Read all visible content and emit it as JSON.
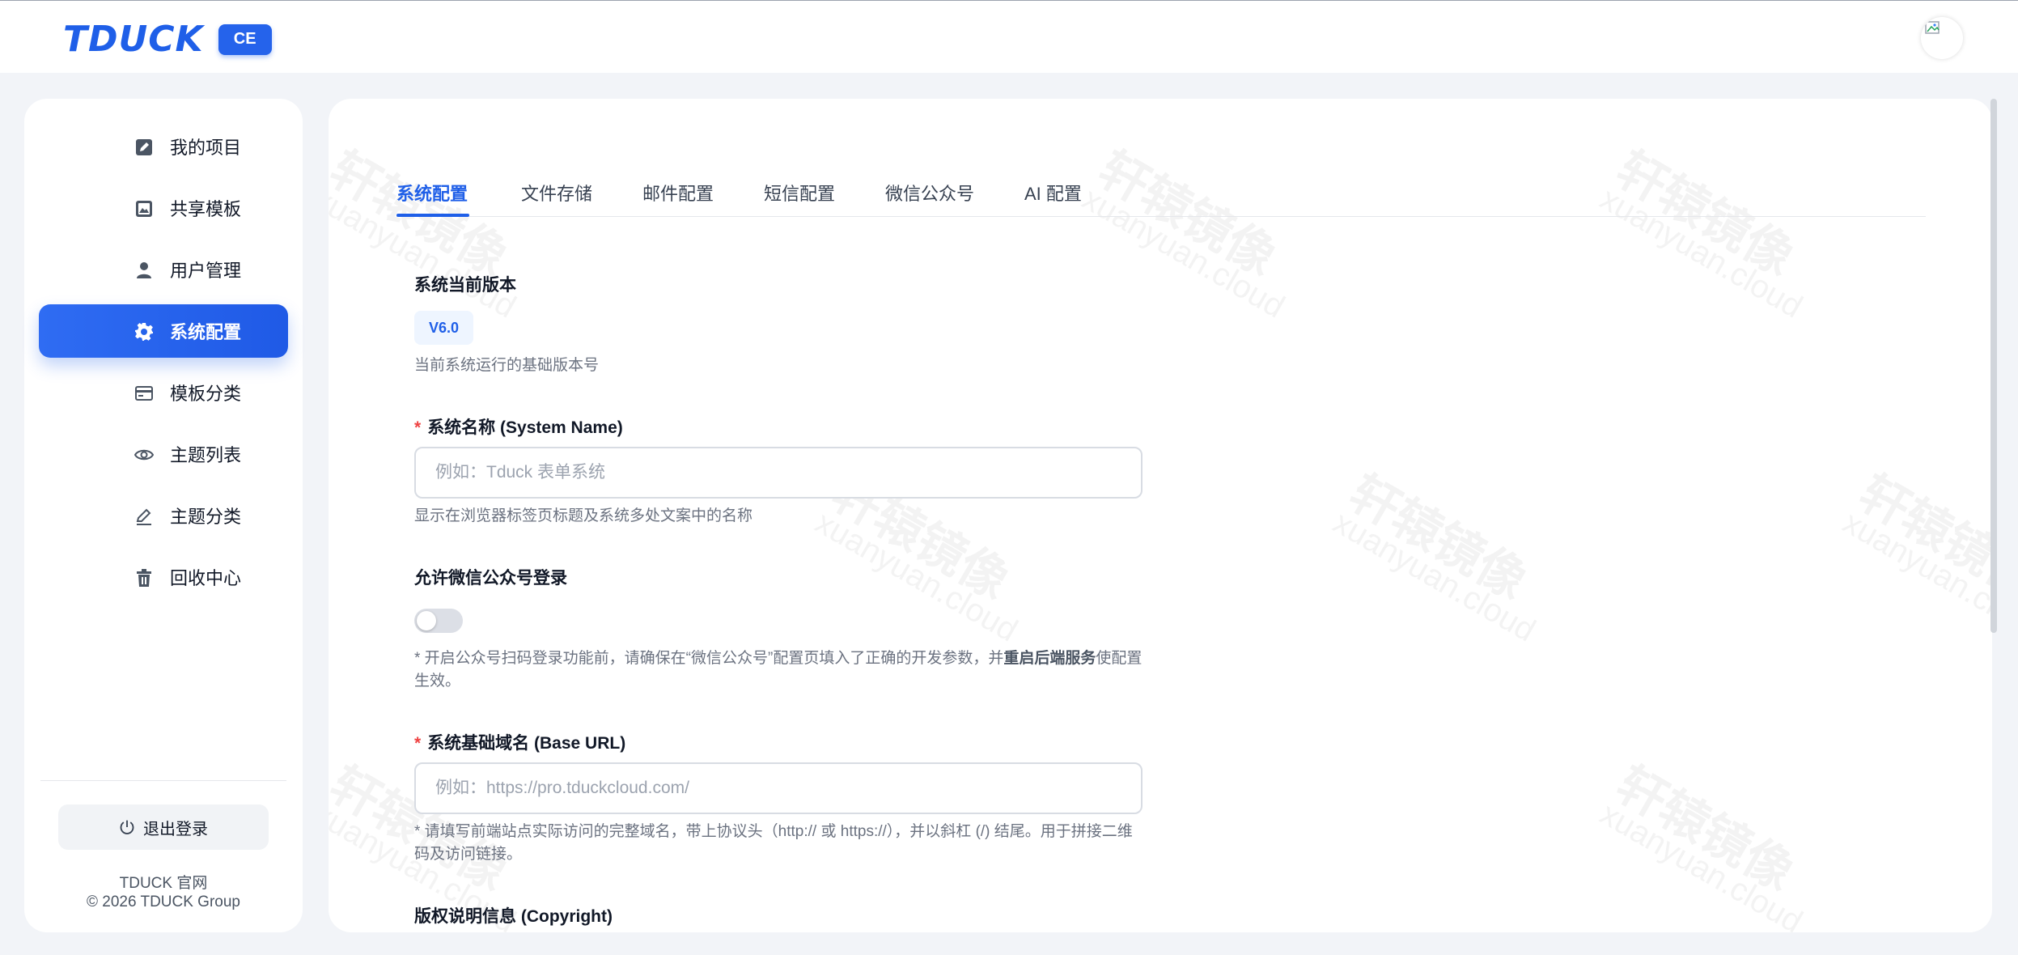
{
  "header": {
    "logo_text": "TDUCK",
    "logo_badge": "CE",
    "avatar_icon": "broken-image-icon"
  },
  "sidebar": {
    "items": [
      {
        "label": "我的项目",
        "icon": "edit-icon",
        "active": false
      },
      {
        "label": "共享模板",
        "icon": "image-frame-icon",
        "active": false
      },
      {
        "label": "用户管理",
        "icon": "user-icon",
        "active": false
      },
      {
        "label": "系统配置",
        "icon": "gear-icon",
        "active": true
      },
      {
        "label": "模板分类",
        "icon": "card-icon",
        "active": false
      },
      {
        "label": "主题列表",
        "icon": "eye-icon",
        "active": false
      },
      {
        "label": "主题分类",
        "icon": "pencil-icon",
        "active": false
      },
      {
        "label": "回收中心",
        "icon": "trash-icon",
        "active": false
      }
    ],
    "logout_label": "退出登录",
    "footer_link": "TDUCK 官网",
    "copyright": "© 2026 TDUCK Group"
  },
  "tabs": [
    {
      "label": "系统配置",
      "active": true
    },
    {
      "label": "文件存储",
      "active": false
    },
    {
      "label": "邮件配置",
      "active": false
    },
    {
      "label": "短信配置",
      "active": false
    },
    {
      "label": "微信公众号",
      "active": false
    },
    {
      "label": "AI 配置",
      "active": false
    }
  ],
  "form": {
    "version": {
      "label": "系统当前版本",
      "value": "V6.0",
      "help": "当前系统运行的基础版本号"
    },
    "system_name": {
      "label": "系统名称 (System Name)",
      "required_mark": "*",
      "value": "",
      "placeholder": "例如：Tduck 表单系统",
      "help": "显示在浏览器标签页标题及系统多处文案中的名称"
    },
    "wechat_login": {
      "label": "允许微信公众号登录",
      "enabled": false,
      "help_prefix": "* 开启公众号扫码登录功能前，请确保在“微信公众号”配置页填入了正确的开发参数，并",
      "help_bold": "重启后端服务",
      "help_suffix": "使配置生效。"
    },
    "base_url": {
      "label": "系统基础域名 (Base URL)",
      "required_mark": "*",
      "value": "",
      "placeholder": "例如：https://pro.tduckcloud.com/",
      "help": "* 请填写前端站点实际访问的完整域名，带上协议头（http:// 或 https://），并以斜杠 (/) 结尾。用于拼接二维码及访问链接。"
    },
    "copyright": {
      "label": "版权说明信息 (Copyright)"
    }
  },
  "watermark": {
    "text": "轩辕镜像",
    "sub": "xuanyuan.cloud"
  },
  "colors": {
    "primary": "#1f5fe8",
    "required": "#ef4444",
    "background": "#f2f4f8"
  }
}
